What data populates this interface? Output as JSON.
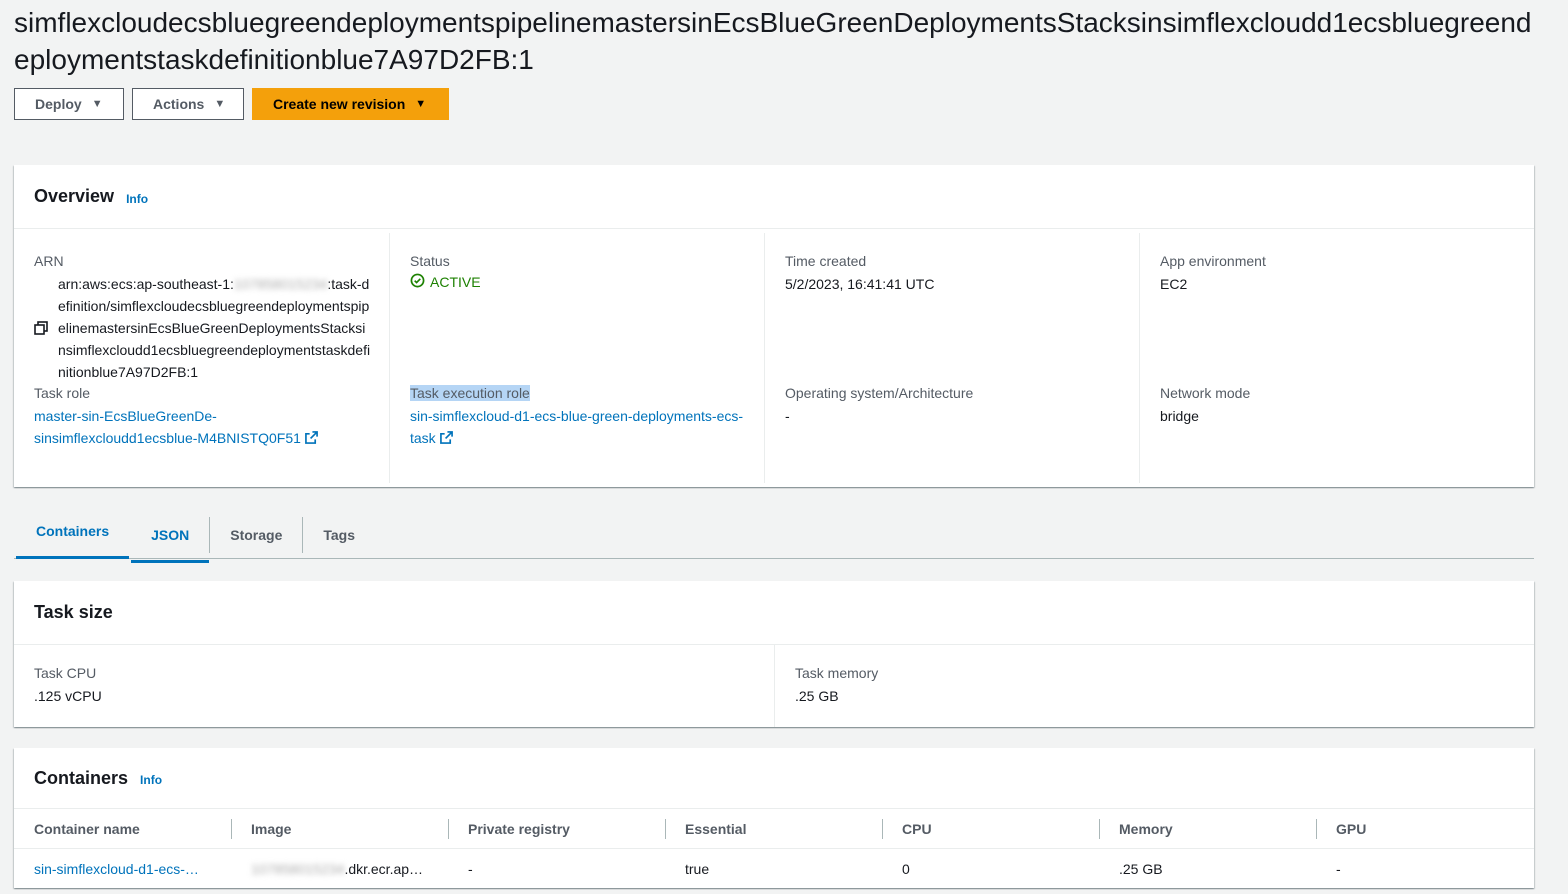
{
  "title": "simflexcloudecsbluegreendeploymentspipelinemastersinEcsBlueGreenDeploymentsStacksinsimflexcloudd1ecsbluegreendeploymentstaskdefinitionblue7A97D2FB:1",
  "buttons": {
    "deploy": "Deploy",
    "actions": "Actions",
    "create": "Create new revision"
  },
  "overview": {
    "heading": "Overview",
    "info": "Info",
    "arn_label": "ARN",
    "arn_prefix": "arn:aws:ecs:ap-southeast-1:",
    "arn_account": "107858015234",
    "arn_suffix": ":task-definition/simflexcloudecsbluegreendeploymentspipelinemastersinEcsBlueGreenDeploymentsStacksinsimflexcloudd1ecsbluegreendeploymentstaskdefinitionblue7A97D2FB:1",
    "status_label": "Status",
    "status_value": "ACTIVE",
    "time_label": "Time created",
    "time_value": "5/2/2023, 16:41:41 UTC",
    "appenv_label": "App environment",
    "appenv_value": "EC2",
    "taskrole_label": "Task role",
    "taskrole_value": "master-sin-EcsBlueGreenDe-sinsimflexcloudd1ecsblue-M4BNISTQ0F51",
    "execrole_label": "Task execution role",
    "execrole_value": "sin-simflexcloud-d1-ecs-blue-green-deployments-ecs-task",
    "os_label": "Operating system/Architecture",
    "os_value": "-",
    "netmode_label": "Network mode",
    "netmode_value": "bridge"
  },
  "tabs": [
    "Containers",
    "JSON",
    "Storage",
    "Tags"
  ],
  "task_size": {
    "heading": "Task size",
    "cpu_label": "Task CPU",
    "cpu_value": ".125 vCPU",
    "mem_label": "Task memory",
    "mem_value": ".25 GB"
  },
  "containers": {
    "heading": "Containers",
    "info": "Info",
    "columns": [
      "Container name",
      "Image",
      "Private registry",
      "Essential",
      "CPU",
      "Memory",
      "GPU"
    ],
    "row": {
      "name": "sin-simflexcloud-d1-ecs-…",
      "image_account": "107858015234",
      "image_suffix": ".dkr.ecr.ap…",
      "registry": "-",
      "essential": "true",
      "cpu": "0",
      "memory": ".25 GB",
      "gpu": "-"
    }
  },
  "colors": {
    "accent": "#0073bb",
    "primary_button": "#f4a00b",
    "active": "#1d8102",
    "highlight": "#b5d5f5"
  },
  "icons": [
    "caret-down-icon",
    "copy-icon",
    "external-link-icon",
    "status-check-icon"
  ]
}
